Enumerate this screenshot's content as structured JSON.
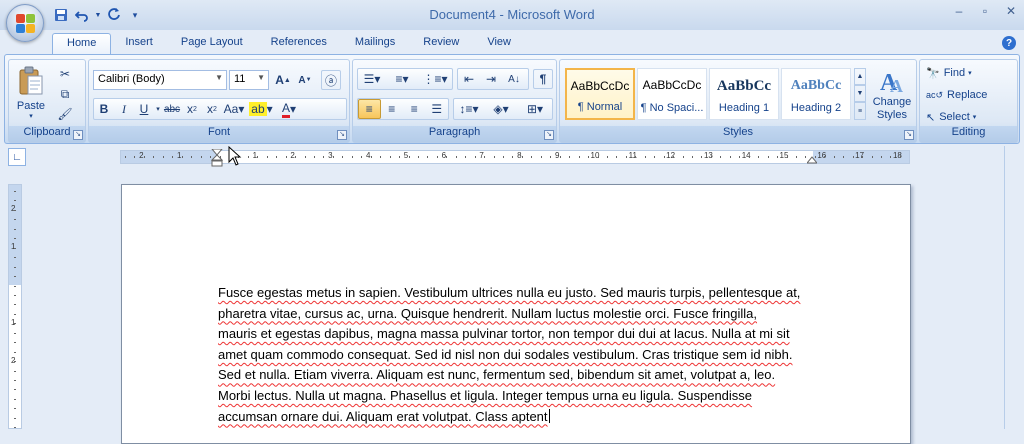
{
  "window": {
    "title": "Document4 - Microsoft Word"
  },
  "quick_access": {
    "icons": [
      "save-icon",
      "undo-icon",
      "redo-icon",
      "customize-icon"
    ]
  },
  "tabs": [
    {
      "label": "Home"
    },
    {
      "label": "Insert"
    },
    {
      "label": "Page Layout"
    },
    {
      "label": "References"
    },
    {
      "label": "Mailings"
    },
    {
      "label": "Review"
    },
    {
      "label": "View"
    }
  ],
  "ribbon": {
    "clipboard": {
      "label": "Clipboard",
      "paste": "Paste"
    },
    "font": {
      "label": "Font",
      "family": "Calibri (Body)",
      "size": "11"
    },
    "paragraph": {
      "label": "Paragraph"
    },
    "styles": {
      "label": "Styles",
      "cards": [
        {
          "sample": "AaBbCcDc",
          "name": "¶ Normal"
        },
        {
          "sample": "AaBbCcDc",
          "name": "¶ No Spaci..."
        },
        {
          "sample": "AaBbCc",
          "name": "Heading 1"
        },
        {
          "sample": "AaBbCc",
          "name": "Heading 2"
        }
      ],
      "change_styles": "Change Styles"
    },
    "editing": {
      "label": "Editing",
      "find": "Find",
      "replace": "Replace",
      "select": "Select"
    }
  },
  "ruler": {
    "ticks": [
      "2",
      "1",
      "1",
      "2",
      "3",
      "4",
      "5",
      "6",
      "7",
      "8",
      "9",
      "10",
      "11",
      "12",
      "13",
      "14",
      "15",
      "16",
      "17",
      "18"
    ]
  },
  "vruler": {
    "ticks": [
      "2",
      "1",
      "1",
      "2"
    ]
  },
  "document": {
    "lines": [
      "Fusce egestas metus in sapien. Vestibulum ultrices nulla eu justo. Sed mauris turpis, pellentesque at,",
      "pharetra vitae, cursus ac, urna. Quisque hendrerit. Nullam luctus molestie orci. Fusce fringilla,",
      "mauris et egestas dapibus, magna massa pulvinar tortor, non tempor dui dui at lacus. Nulla at mi sit",
      "amet quam commodo consequat. Sed id nisl non dui sodales vestibulum. Cras tristique sem id nibh.",
      "Sed et nulla. Etiam viverra. Aliquam est nunc, fermentum sed, bibendum sit amet, volutpat a, leo.",
      "Morbi lectus. Nulla ut magna. Phasellus et ligula.  Integer tempus urna eu ligula. Suspendisse",
      "accumsan ornare dui. Aliquam erat volutpat. Class aptent"
    ]
  }
}
